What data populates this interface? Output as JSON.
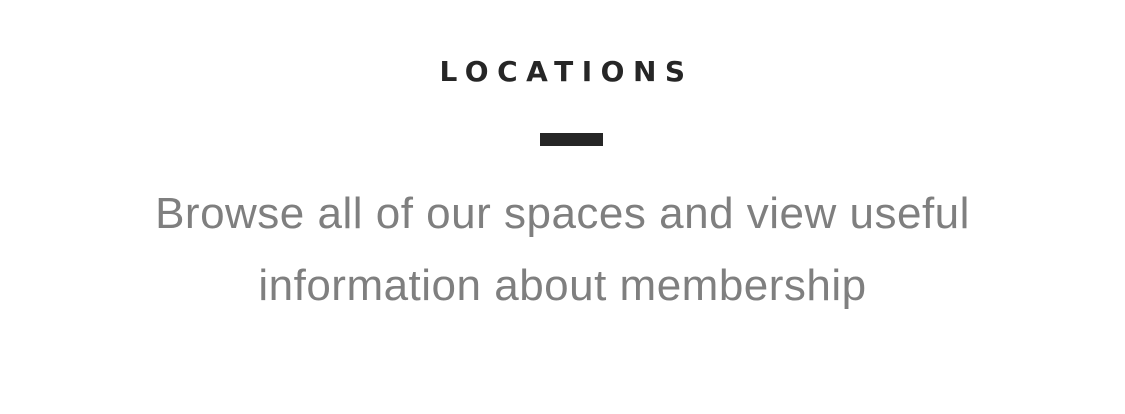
{
  "section": {
    "heading": "LOCATIONS",
    "description_line1": "Browse all of our spaces and view useful",
    "description_line2": "information about membership"
  },
  "colors": {
    "heading": "#262626",
    "divider": "#262626",
    "description": "#7f7f7f",
    "background": "#ffffff"
  }
}
